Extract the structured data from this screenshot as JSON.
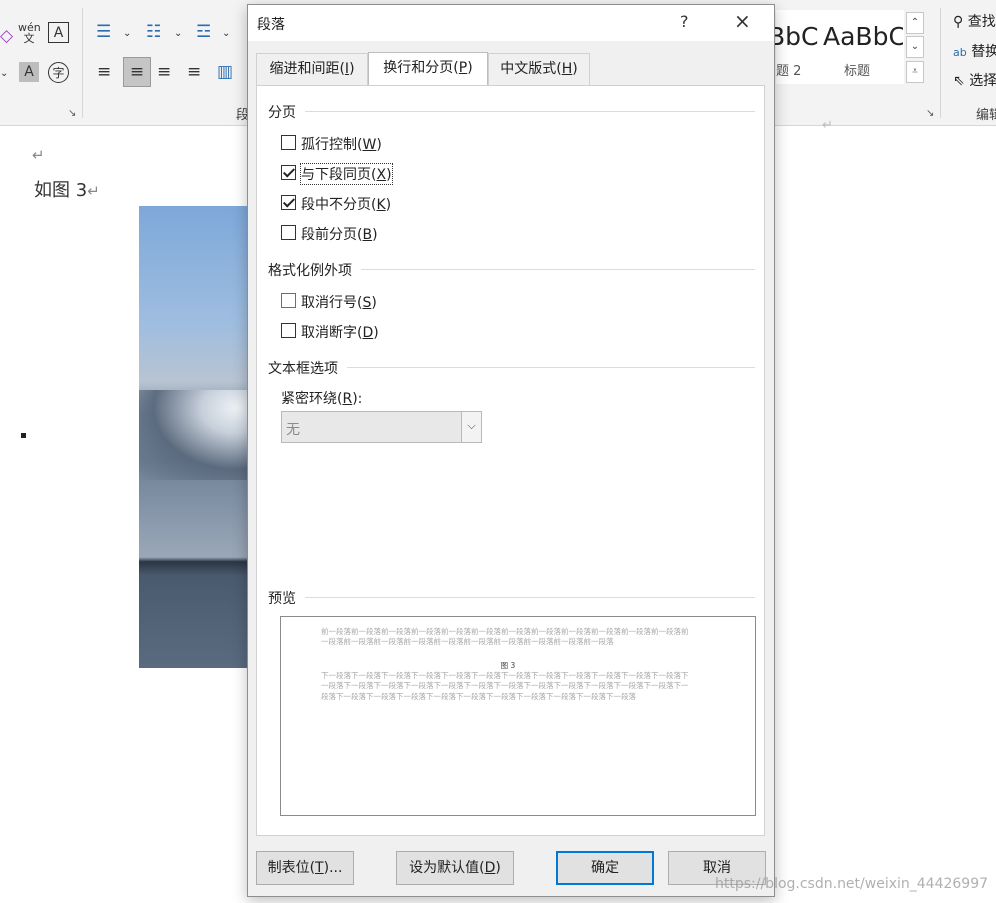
{
  "ribbon": {
    "styles": [
      {
        "sample": "BbC",
        "name": "题 2"
      },
      {
        "sample": "AaBbC",
        "name": "标题"
      }
    ],
    "editing": {
      "find": "查找",
      "replace": "替换",
      "select": "选择",
      "group_label": "编辑"
    },
    "paragraph_group_label": "段",
    "colors": {
      "ribbon_bg": "#f3f3f3",
      "accent": "#0078d7"
    }
  },
  "document": {
    "caption_text": "如图 3",
    "return_mark": "↵"
  },
  "dialog": {
    "title": "段落",
    "help": "?",
    "close": "×",
    "tabs": [
      {
        "label": "缩进和间距(I)",
        "active": false
      },
      {
        "label": "换行和分页(P)",
        "active": true
      },
      {
        "label": "中文版式(H)",
        "active": false
      }
    ],
    "pagination": {
      "heading": "分页",
      "widow_control": {
        "label": "孤行控制(W)",
        "checked": false
      },
      "keep_with_next": {
        "label": "与下段同页(X)",
        "checked": true
      },
      "keep_lines_together": {
        "label": "段中不分页(K)",
        "checked": true
      },
      "page_break_before": {
        "label": "段前分页(B)",
        "checked": false
      }
    },
    "formatting_exceptions": {
      "heading": "格式化例外项",
      "suppress_line_numbers": {
        "label": "取消行号(S)",
        "checked": false
      },
      "no_hyphenation": {
        "label": "取消断字(D)",
        "checked": false
      }
    },
    "textbox_options": {
      "heading": "文本框选项",
      "tight_wrap_label": "紧密环绕(R):",
      "tight_wrap_value": "无"
    },
    "preview": {
      "heading": "预览",
      "before_text": "前一段落前一段落前一段落前一段落前一段落前一段落前一段落前一段落前一段落前一段落前一段落前一段落前一段落前一段落前一段落前一段落前一段落前一段落前一段落前一段落前一段落前一段落",
      "caption": "图 3",
      "after_text": "下一段落下一段落下一段落下一段落下一段落下一段落下一段落下一段落下一段落下一段落下一段落下一段落下一段落下一段落下一段落下一段落下一段落下一段落下一段落下一段落下一段落下一段落下一段落下一段落下一段落下一段落下一段落下一段落下一段落下一段落下一段落下一段落下一段落下一段落下一段落"
    },
    "buttons": {
      "tabs": "制表位(T)...",
      "set_default": "设为默认值(D)",
      "ok": "确定",
      "cancel": "取消"
    }
  },
  "watermark": "https://blog.csdn.net/weixin_44426997"
}
